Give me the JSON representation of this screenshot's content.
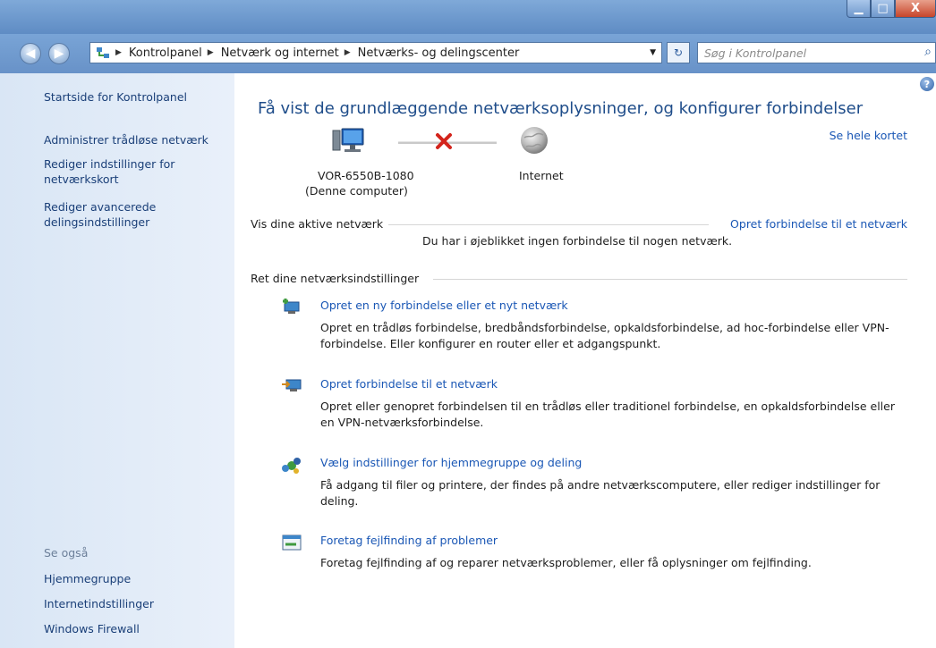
{
  "window": {
    "min_label": "▁",
    "max_label": "□",
    "close_label": "X"
  },
  "address": {
    "back_glyph": "◀",
    "forward_glyph": "▶",
    "crumbs": [
      "Kontrolpanel",
      "Netværk og internet",
      "Netværks- og delingscenter"
    ],
    "search_placeholder": "Søg i Kontrolpanel"
  },
  "sidebar": {
    "home": "Startside for Kontrolpanel",
    "links": [
      "Administrer trådløse netværk",
      "Rediger indstillinger for netværkskort",
      "Rediger avancerede delingsindstillinger"
    ],
    "see_also_title": "Se også",
    "see_also": [
      "Hjemmegruppe",
      "Internetindstillinger",
      "Windows Firewall"
    ]
  },
  "main": {
    "title": "Få vist de grundlæggende netværksoplysninger, og konfigurer forbindelser",
    "full_map_link": "Se hele kortet",
    "computer_name": "VOR-6550B-1080",
    "computer_sub": "(Denne computer)",
    "internet_label": "Internet",
    "active_networks_label": "Vis dine aktive netværk",
    "connect_link": "Opret forbindelse til et netværk",
    "no_connection_text": "Du har i øjeblikket ingen forbindelse til nogen netværk.",
    "settings_label": "Ret dine netværksindstillinger",
    "tasks": [
      {
        "title": "Opret en ny forbindelse eller et nyt netværk",
        "desc": "Opret en trådløs forbindelse, bredbåndsforbindelse, opkaldsforbindelse, ad hoc-forbindelse eller VPN-forbindelse. Eller konfigurer en router eller et adgangspunkt."
      },
      {
        "title": "Opret forbindelse til et netværk",
        "desc": "Opret eller genopret forbindelsen til en trådløs eller traditionel forbindelse, en opkaldsforbindelse eller en VPN-netværksforbindelse."
      },
      {
        "title": "Vælg indstillinger for hjemmegruppe og deling",
        "desc": "Få adgang til filer og printere, der findes på andre netværkscomputere, eller rediger indstillinger for deling."
      },
      {
        "title": "Foretag fejlfinding af problemer",
        "desc": "Foretag fejlfinding af og reparer netværksproblemer, eller få oplysninger om fejlfinding."
      }
    ]
  }
}
